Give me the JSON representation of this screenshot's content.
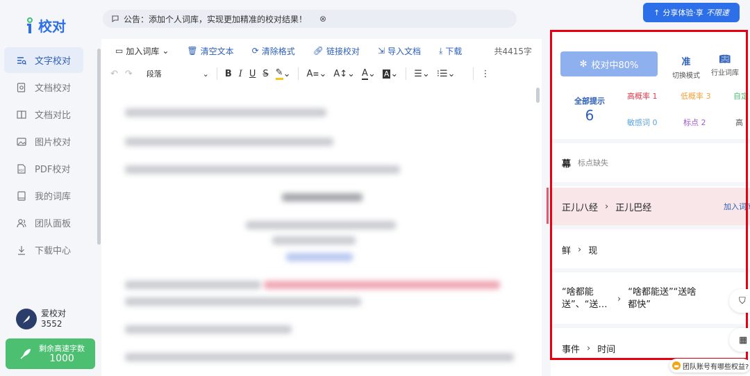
{
  "app": {
    "logo_text": "校对"
  },
  "sidebar": {
    "items": [
      {
        "label": "文字校对",
        "icon": "text-check-icon",
        "active": true
      },
      {
        "label": "文档校对",
        "icon": "document-check-icon"
      },
      {
        "label": "文档对比",
        "icon": "document-compare-icon"
      },
      {
        "label": "图片校对",
        "icon": "image-check-icon"
      },
      {
        "label": "PDF校对",
        "icon": "pdf-icon"
      },
      {
        "label": "我的词库",
        "icon": "book-icon"
      },
      {
        "label": "团队面板",
        "icon": "team-icon"
      },
      {
        "label": "下载中心",
        "icon": "download-icon"
      }
    ],
    "user": {
      "name": "爱校对",
      "id": "3552"
    },
    "quota": {
      "label": "剩余高速字数",
      "value": "1000"
    }
  },
  "notice": {
    "text": "公告：添加个人词库，实现更加精准的校对结果！"
  },
  "share": {
    "label": "分享体验·享",
    "emphasis": "不限速"
  },
  "editor": {
    "toolbar": {
      "add_dict": "加入词库",
      "clear_text": "清空文本",
      "clear_format": "清除格式",
      "link_check": "链接校对",
      "import_doc": "导入文档",
      "download": "下载",
      "word_count": "共4415字"
    },
    "paragraph_select": "段落"
  },
  "panel": {
    "checking_label": "校对中80%",
    "mode_label": "切换模式",
    "mode_icon_text": "准",
    "industry_label": "行业词库",
    "all_tips_label": "全部提示",
    "all_tips_count": "6",
    "categories": {
      "high": "高概率 1",
      "low": "低概率 3",
      "custom": "自定",
      "sensitive": "敏感词 0",
      "punct": "标点 2",
      "high_risk": "高"
    },
    "issues": [
      {
        "word": "幕",
        "note": "标点缺失"
      },
      {
        "from": "正儿八经",
        "to": "正儿巴经",
        "action": "加入词库"
      },
      {
        "from": "鲜",
        "to": "现"
      },
      {
        "from": "“啥都能送”、“送…",
        "to": "“啥都能送”“送啥都快”"
      },
      {
        "from": "事件",
        "to": "时间"
      }
    ],
    "team_badge": "团队账号有哪些权益?"
  },
  "colors": {
    "accent": "#2c6fe8",
    "success": "#4cc070",
    "danger": "#e60012"
  }
}
